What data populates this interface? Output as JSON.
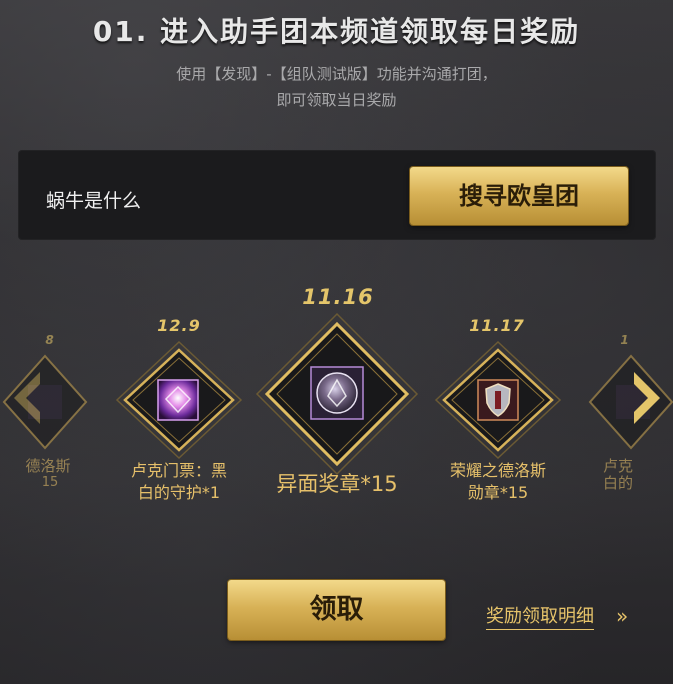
{
  "header": {
    "title": "01. 进入助手团本频道领取每日奖励",
    "subtitle_line1": "使用【发现】-【组队测试版】功能并沟通打团，",
    "subtitle_line2": "即可领取当日奖励"
  },
  "panel": {
    "label": "蜗牛是什么",
    "search_button": "搜寻欧皇团"
  },
  "rewards": {
    "left_partial": {
      "date": "8",
      "name_line1": "德洛斯",
      "name_line2": "15"
    },
    "items": [
      {
        "date": "12.9",
        "name_line1": "卢克门票：黑",
        "name_line2": "白的守护*1",
        "icon": "ticket-icon"
      },
      {
        "date": "11.16",
        "name_line1": "异面奖章*15",
        "name_line2": "",
        "icon": "medal-icon"
      },
      {
        "date": "11.17",
        "name_line1": "荣耀之德洛斯",
        "name_line2": "勋章*15",
        "icon": "shield-medal-icon"
      }
    ],
    "right_partial": {
      "date": "1",
      "name_line1": "卢克",
      "name_line2": "白的"
    }
  },
  "actions": {
    "claim_button": "领取",
    "detail_link": "奖励领取明细",
    "detail_chevron": "»"
  },
  "colors": {
    "gold": "#e4c56a",
    "button_gold": "#d8b257",
    "panel": "#1b1b1d"
  }
}
